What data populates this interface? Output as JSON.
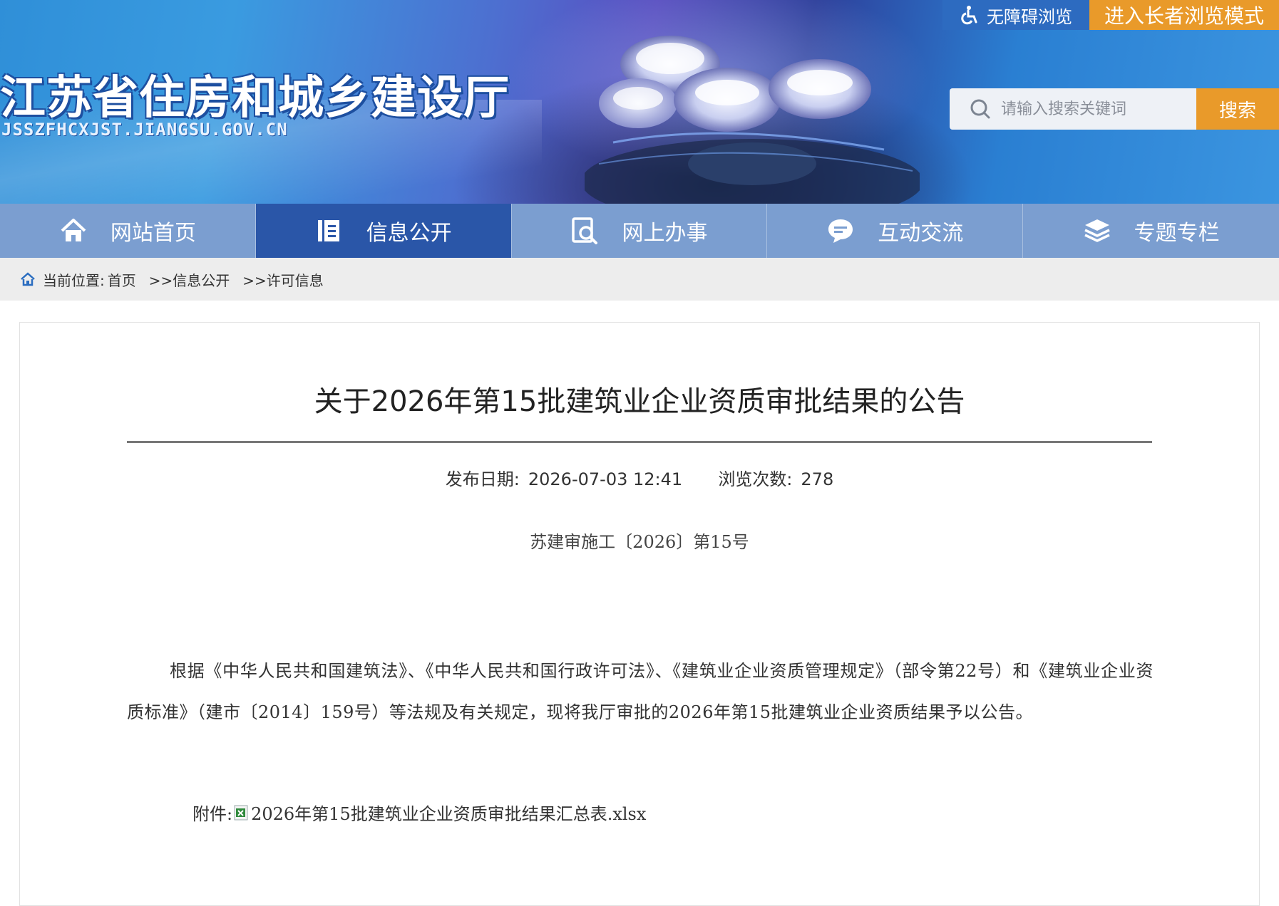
{
  "header": {
    "site_title": "江苏省住房和城乡建设厅",
    "site_domain": "JSSZFHCXJST.JIANGSU.GOV.CN",
    "accessibility_label": "无障碍浏览",
    "elder_mode_label": "进入长者浏览模式",
    "search_placeholder": "请输入搜索关键词",
    "search_button": "搜索"
  },
  "nav": {
    "items": [
      {
        "label": "网站首页",
        "icon": "home-icon",
        "active": false
      },
      {
        "label": "信息公开",
        "icon": "document-icon",
        "active": true
      },
      {
        "label": "网上办事",
        "icon": "search-service-icon",
        "active": false
      },
      {
        "label": "互动交流",
        "icon": "chat-icon",
        "active": false
      },
      {
        "label": "专题专栏",
        "icon": "layers-icon",
        "active": false
      }
    ]
  },
  "breadcrumb": {
    "prefix": "当前位置:",
    "home": "首页",
    "level1": ">>信息公开",
    "level2": ">>许可信息"
  },
  "article": {
    "title": "关于2026年第15批建筑业企业资质审批结果的公告",
    "publish_label": "发布日期:",
    "publish_date": "2026-07-03 12:41",
    "views_label": "浏览次数:",
    "views": "278",
    "doc_number": "苏建审施工〔2026〕第15号",
    "body": "根据《中华人民共和国建筑法》、《中华人民共和国行政许可法》、《建筑业企业资质管理规定》（部令第22号）和《建筑业企业资质标准》（建市〔2014〕159号）等法规及有关规定，现将我厅审批的2026年第15批建筑业企业资质结果予以公告。",
    "attachment_label": "附件:",
    "attachment_name": "2026年第15批建筑业企业资质审批结果汇总表.xlsx"
  },
  "colors": {
    "nav_bg": "#7b9ed0",
    "nav_active": "#2a56a8",
    "accent_orange": "#e99a2a"
  }
}
